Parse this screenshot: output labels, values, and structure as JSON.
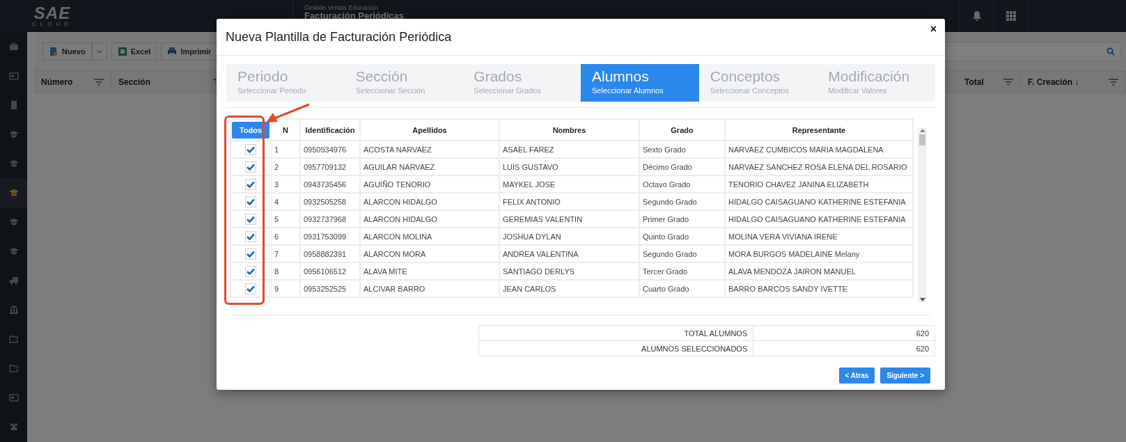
{
  "topbar": {
    "logo": "SAE",
    "logo_sub": "CLOUD",
    "module": "Gestión Ventas Educación",
    "page_title": "Facturación Periódicas"
  },
  "sidebar": {
    "items": [
      {
        "selected": false
      },
      {
        "selected": false
      },
      {
        "selected": false
      },
      {
        "selected": false
      },
      {
        "selected": false
      },
      {
        "selected": true
      },
      {
        "selected": false
      },
      {
        "selected": false
      },
      {
        "selected": false
      },
      {
        "selected": false
      },
      {
        "selected": false
      },
      {
        "selected": false
      },
      {
        "selected": false
      },
      {
        "selected": false
      }
    ]
  },
  "toolbar": {
    "buttons": [
      {
        "label": "Nuevo"
      },
      {
        "label": "Excel"
      },
      {
        "label": "Imprimir"
      }
    ]
  },
  "grid": {
    "columns": [
      {
        "label": "Número"
      },
      {
        "label": "Sección"
      },
      {
        "label": "Total"
      },
      {
        "label": "F. Creación ↓"
      }
    ]
  },
  "modal": {
    "title": "Nueva Plantilla de Facturación Periódica",
    "close": "×",
    "steps": [
      {
        "title": "Periodo",
        "subtitle": "Seleccionar Periodo",
        "selected": false
      },
      {
        "title": "Sección",
        "subtitle": "Seleccionar Sección",
        "selected": false
      },
      {
        "title": "Grados",
        "subtitle": "Seleccionar Grados",
        "selected": false
      },
      {
        "title": "Alumnos",
        "subtitle": "Seleccionar Alumnos",
        "selected": true
      },
      {
        "title": "Conceptos",
        "subtitle": "Seleccionar Conceptos",
        "selected": false
      },
      {
        "title": "Modificación",
        "subtitle": "Modificar Valores",
        "selected": false
      }
    ],
    "table": {
      "select_all": "Todos",
      "columns": [
        "N",
        "Identificación",
        "Apellidos",
        "Nombres",
        "Grado",
        "Representante"
      ],
      "rows": [
        {
          "checked": true,
          "cells": [
            "1",
            "0950934976",
            "ACOSTA NARVAEZ",
            "ASAEL FAREZ",
            "Sexto Grado",
            "NARVAEZ CUMBICOS MARIA MAGDALENA"
          ]
        },
        {
          "checked": true,
          "cells": [
            "2",
            "0957709132",
            "AGUILAR NARVAEZ",
            "LUIS GUSTAVO",
            "Décimo Grado",
            "NARVAEZ SANCHEZ ROSA ELENA DEL ROSARIO"
          ]
        },
        {
          "checked": true,
          "cells": [
            "3",
            "0943735456",
            "AGUIÑO TENORIO",
            "MAYKEL JOSE",
            "Octavo Grado",
            "TENORIO CHAVEZ JANINA ELIZABETH"
          ]
        },
        {
          "checked": true,
          "cells": [
            "4",
            "0932505258",
            "ALARCON HIDALGO",
            "FELIX ANTONIO",
            "Segundo Grado",
            "HIDALGO CAISAGUANO KATHERINE ESTEFANIA"
          ]
        },
        {
          "checked": true,
          "cells": [
            "5",
            "0932737968",
            "ALARCON HIDALGO",
            "GEREMIAS VALENTIN",
            "Primer Grado",
            "HIDALGO CAISAGUANO KATHERINE ESTEFANIA"
          ]
        },
        {
          "checked": true,
          "cells": [
            "6",
            "0931753099",
            "ALARCON MOLINA",
            "JOSHUA DYLAN",
            "Quinto Grado",
            "MOLINA VERA VIVIANA IRENE"
          ]
        },
        {
          "checked": true,
          "cells": [
            "7",
            "0958882391",
            "ALARCON MORA",
            "ANDREA VALENTINA",
            "Segundo Grado",
            "MORA BURGOS MADELAINE Melany"
          ]
        },
        {
          "checked": true,
          "cells": [
            "8",
            "0956106512",
            "ALAVA MITE",
            "SANTIAGO DERLYS",
            "Tercer Grado",
            "ALAVA MENDOZA JAIRON MANUEL"
          ]
        },
        {
          "checked": true,
          "cells": [
            "9",
            "0953252525",
            "ALCIVAR BARRO",
            "JEAN CARLOS",
            "Cuarto Grado",
            "BARRO BARCOS SANDY IVETTE"
          ]
        }
      ]
    },
    "summary": [
      {
        "label": "TOTAL ALUMNOS",
        "value": "620"
      },
      {
        "label": "ALUMNOS SELECCIONADOS",
        "value": "620"
      }
    ],
    "buttons": [
      {
        "label": "< Atras"
      },
      {
        "label": "Siguiente >"
      }
    ]
  }
}
